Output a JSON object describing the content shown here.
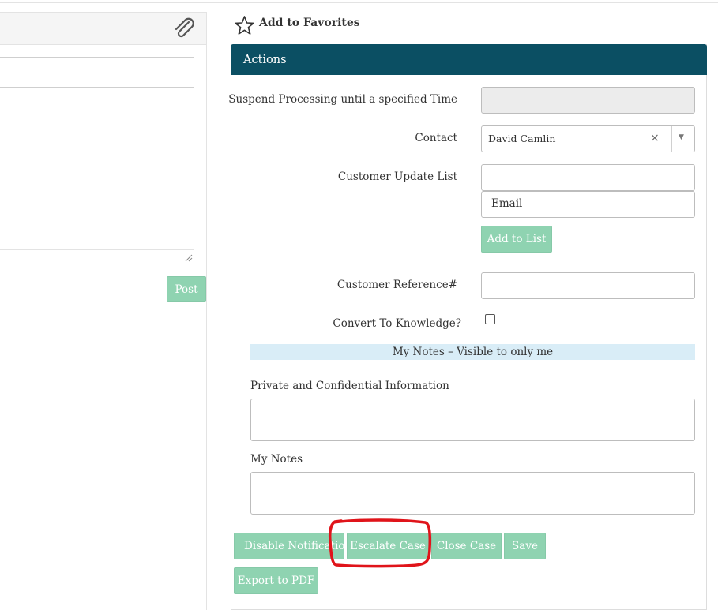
{
  "favorites": {
    "label": "Add to Favorites"
  },
  "left": {
    "post_label": "Post"
  },
  "actions": {
    "title": "Actions",
    "suspend_label": "Suspend Processing until a specified Time",
    "contact_label": "Contact",
    "contact_value": "David Camlin",
    "contact_clear": "×",
    "contact_arrow": "▼",
    "customer_update_label": "Customer Update List",
    "email_placeholder": "Email",
    "add_to_list_label": "Add to List",
    "customer_reference_label": "Customer Reference#",
    "convert_label": "Convert To Knowledge?",
    "my_notes_banner": "My Notes – Visible to only me",
    "private_label": "Private and Confidential Information",
    "my_notes_label": "My Notes"
  },
  "buttons": {
    "disable_notifications": "Disable Notifications",
    "escalate_case": "Escalate Case",
    "close_case": "Close Case",
    "save": "Save",
    "export_pdf": "Export to PDF"
  },
  "colors": {
    "header_bg": "#0b4f63",
    "button_bg": "#8fd3b1",
    "notes_banner_bg": "#d9edf7",
    "annotation_red": "#e0141a"
  },
  "icons": {
    "attachment": "paperclip-icon",
    "favorite": "star-outline-icon"
  }
}
